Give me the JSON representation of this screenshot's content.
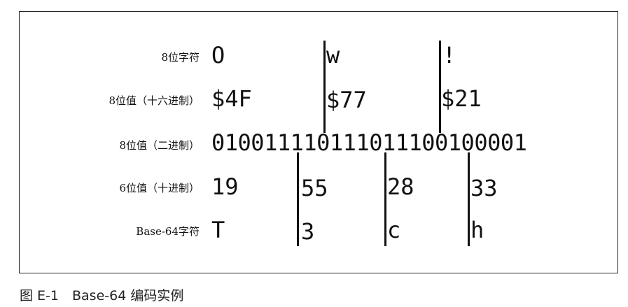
{
  "rows": [
    {
      "label": "8位字符",
      "values": [
        "O",
        "w",
        "!"
      ]
    },
    {
      "label": "8位值（十六进制）",
      "values": [
        "$4F",
        "$77",
        "$21"
      ]
    },
    {
      "label": "8位值（二进制）",
      "bits": "010011110111011100100001"
    },
    {
      "label": "6位值（十进制）",
      "values": [
        "19",
        "55",
        "28",
        "33"
      ]
    },
    {
      "label": "Base-64字符",
      "values": [
        "T",
        "3",
        "c",
        "h"
      ]
    }
  ],
  "caption": "图 E-1　Base-64 编码实例"
}
